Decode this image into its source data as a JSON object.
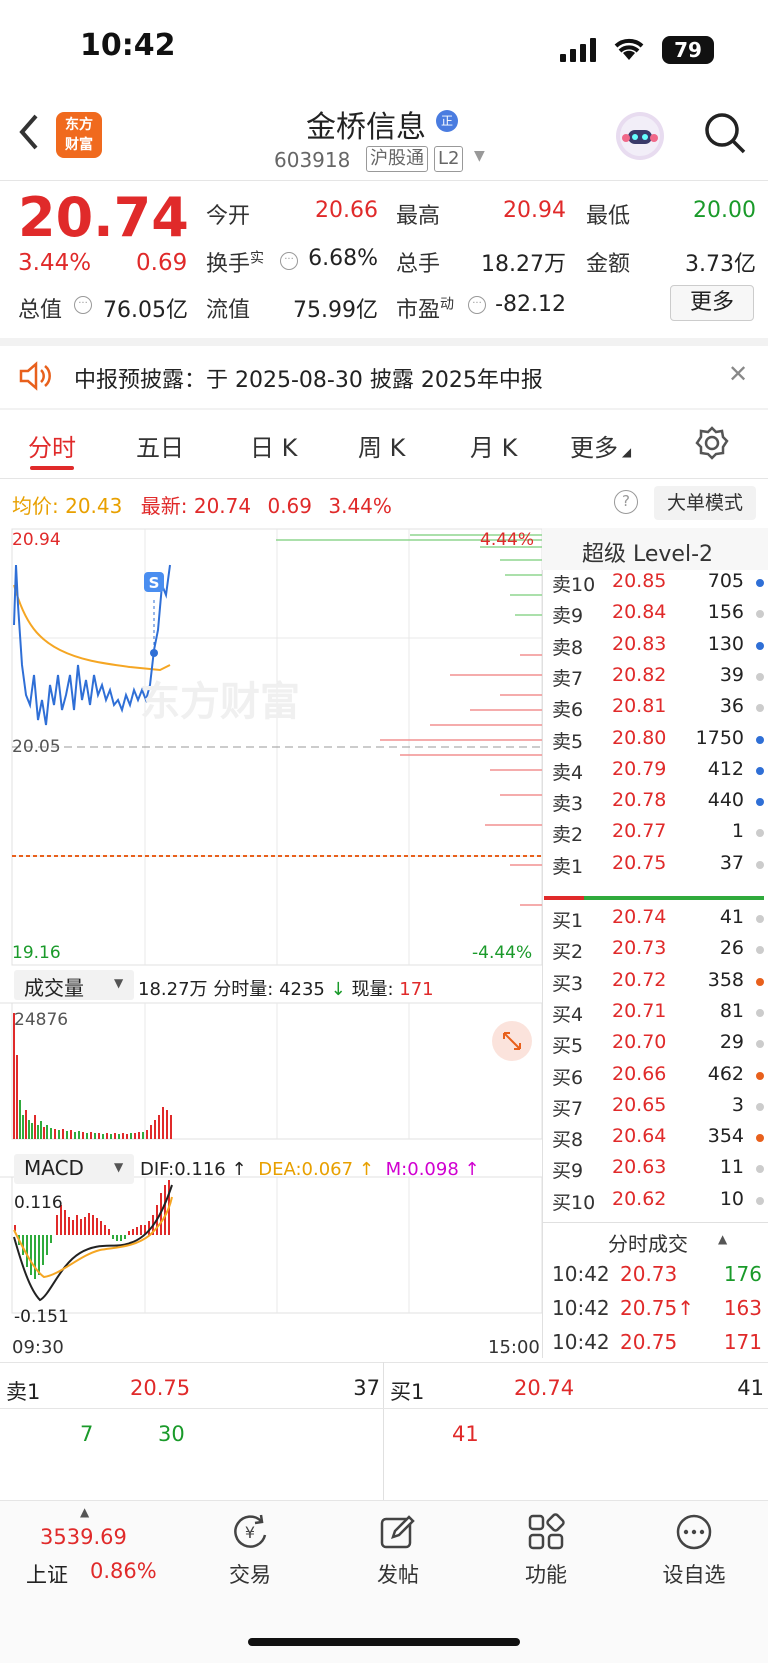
{
  "status_bar": {
    "time": "10:42",
    "battery": "79"
  },
  "header": {
    "logo_text_1": "东方",
    "logo_text_2": "财富",
    "stock_name": "金桥信息",
    "name_badge": "正",
    "stock_code": "603918",
    "tag_connect": "沪股通",
    "tag_level": "L2"
  },
  "quote": {
    "price": "20.74",
    "change_pct": "3.44%",
    "change_amt": "0.69",
    "open_label": "今开",
    "open": "20.66",
    "high_label": "最高",
    "high": "20.94",
    "low_label": "最低",
    "low": "20.00",
    "turnover_label": "换手",
    "turnover_sup": "实",
    "turnover": "6.68%",
    "volume_label": "总手",
    "volume": "18.27万",
    "amount_label": "金额",
    "amount": "3.73亿",
    "mktcap_label": "总值",
    "mktcap": "76.05亿",
    "float_label": "流值",
    "float": "75.99亿",
    "pe_label": "市盈",
    "pe_sup": "动",
    "pe": "-82.12",
    "more_button": "更多"
  },
  "notice": {
    "text": "中报预披露：于 2025-08-30 披露 2025年中报"
  },
  "tabs": [
    "分时",
    "五日",
    "日 K",
    "周 K",
    "月 K",
    "更多"
  ],
  "avg_row": {
    "avg_label": "均价:",
    "avg": "20.43",
    "latest_label": "最新:",
    "latest": "20.74",
    "chg": "0.69",
    "pct": "3.44%",
    "bigorder_button": "大单模式"
  },
  "chart_axes": {
    "price_top": "20.94",
    "price_mid": "20.05",
    "price_bottom": "19.16",
    "pct_top": "4.44%",
    "pct_bottom": "-4.44%",
    "vol_max": "24876",
    "macd_top": "0.116",
    "macd_bottom": "-0.151",
    "time_start": "09:30",
    "time_end": "15:00",
    "s_marker": "S"
  },
  "volume_bar": {
    "dropdown": "成交量",
    "total": "18.27万",
    "min_vol_label": "分时量:",
    "min_vol": "4235",
    "cur_label": "现量:",
    "cur": "171"
  },
  "macd_bar": {
    "dropdown": "MACD",
    "dif": "DIF:0.116 ↑",
    "dea": "DEA:0.067 ↑",
    "m": "M:0.098 ↑"
  },
  "order_book": {
    "title": "超级 Level-2",
    "asks": [
      {
        "label": "卖10",
        "price": "20.85",
        "vol": "705",
        "dot": "#2f6fd6"
      },
      {
        "label": "卖9",
        "price": "20.84",
        "vol": "156",
        "dot": "#cccccc"
      },
      {
        "label": "卖8",
        "price": "20.83",
        "vol": "130",
        "dot": "#2f6fd6"
      },
      {
        "label": "卖7",
        "price": "20.82",
        "vol": "39",
        "dot": "#cccccc"
      },
      {
        "label": "卖6",
        "price": "20.81",
        "vol": "36",
        "dot": "#cccccc"
      },
      {
        "label": "卖5",
        "price": "20.80",
        "vol": "1750",
        "dot": "#2f6fd6"
      },
      {
        "label": "卖4",
        "price": "20.79",
        "vol": "412",
        "dot": "#2f6fd6"
      },
      {
        "label": "卖3",
        "price": "20.78",
        "vol": "440",
        "dot": "#2f6fd6"
      },
      {
        "label": "卖2",
        "price": "20.77",
        "vol": "1",
        "dot": "#cccccc"
      },
      {
        "label": "卖1",
        "price": "20.75",
        "vol": "37",
        "dot": "#cccccc"
      }
    ],
    "bids": [
      {
        "label": "买1",
        "price": "20.74",
        "vol": "41",
        "dot": "#cccccc"
      },
      {
        "label": "买2",
        "price": "20.73",
        "vol": "26",
        "dot": "#cccccc"
      },
      {
        "label": "买3",
        "price": "20.72",
        "vol": "358",
        "dot": "#e8601c"
      },
      {
        "label": "买4",
        "price": "20.71",
        "vol": "81",
        "dot": "#cccccc"
      },
      {
        "label": "买5",
        "price": "20.70",
        "vol": "29",
        "dot": "#cccccc"
      },
      {
        "label": "买6",
        "price": "20.66",
        "vol": "462",
        "dot": "#e8601c"
      },
      {
        "label": "买7",
        "price": "20.65",
        "vol": "3",
        "dot": "#cccccc"
      },
      {
        "label": "买8",
        "price": "20.64",
        "vol": "354",
        "dot": "#e8601c"
      },
      {
        "label": "买9",
        "price": "20.63",
        "vol": "11",
        "dot": "#cccccc"
      },
      {
        "label": "买10",
        "price": "20.62",
        "vol": "10",
        "dot": "#cccccc"
      }
    ]
  },
  "ticks": {
    "title": "分时成交",
    "rows": [
      {
        "time": "10:42",
        "price": "20.73",
        "vol": "176",
        "vol_color": "#1a9a2a"
      },
      {
        "time": "10:42",
        "price": "20.75↑",
        "vol": "163",
        "vol_color": "#e02a2a"
      },
      {
        "time": "10:42",
        "price": "20.75",
        "vol": "171",
        "vol_color": "#e02a2a"
      }
    ]
  },
  "depth": {
    "ask_label": "卖1",
    "ask_price": "20.75",
    "ask_vol": "37",
    "bid_label": "买1",
    "bid_price": "20.74",
    "bid_vol": "41",
    "ask_split_1": "7",
    "ask_split_2": "30",
    "bid_split_1": "41"
  },
  "bottom_nav": {
    "index_value": "3539.69",
    "index_name": "上证",
    "index_pct": "0.86%",
    "items": [
      "交易",
      "发帖",
      "功能",
      "设自选"
    ]
  }
}
